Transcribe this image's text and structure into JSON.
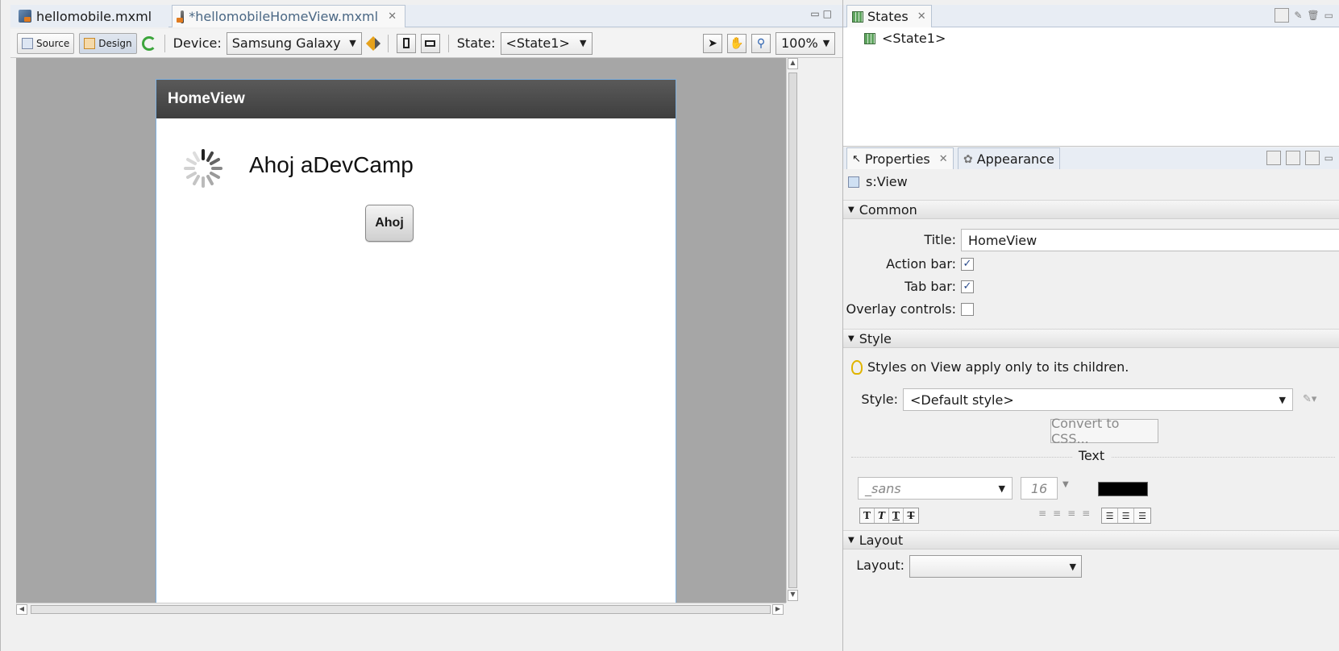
{
  "editor": {
    "tabs": [
      {
        "label": "hellomobile.mxml",
        "active": false
      },
      {
        "label": "*hellomobileHomeView.mxml",
        "active": true
      }
    ],
    "toolbar": {
      "source_label": "Source",
      "design_label": "Design",
      "device_label": "Device:",
      "device_value": "Samsung Galaxy Tᵢ",
      "state_label": "State:",
      "state_value": "<State1>",
      "zoom_value": "100%"
    },
    "preview": {
      "action_bar_title": "HomeView",
      "greeting_text": "Ahoj aDevCamp",
      "button_label": "Ahoj"
    }
  },
  "states_panel": {
    "tab_label": "States",
    "items": [
      "<State1>"
    ]
  },
  "properties_panel": {
    "tabs": [
      "Properties",
      "Appearance"
    ],
    "component": "s:View",
    "common": {
      "header": "Common",
      "title_label": "Title:",
      "title_value": "HomeView",
      "action_bar_label": "Action bar:",
      "action_bar_checked": true,
      "tab_bar_label": "Tab bar:",
      "tab_bar_checked": true,
      "overlay_label": "Overlay controls:",
      "overlay_checked": false
    },
    "style": {
      "header": "Style",
      "hint": "Styles on View apply only to its children.",
      "style_label": "Style:",
      "style_value": "<Default style>",
      "convert_button": "Convert to CSS...",
      "text_header": "Text",
      "font_value": "_sans",
      "font_size": "16",
      "text_color": "#000000",
      "format_buttons": [
        "T",
        "T",
        "T",
        "T"
      ]
    },
    "layout": {
      "header": "Layout",
      "layout_label": "Layout:",
      "layout_value": ""
    }
  },
  "colors": {
    "action_bar": "#4a4a4a",
    "canvas_bg": "#a6a6a6",
    "device_border": "#7fb0de"
  }
}
